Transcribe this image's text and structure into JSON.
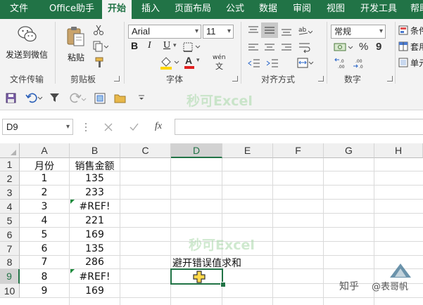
{
  "menu": {
    "tabs": [
      "文件",
      "Office助手",
      "开始",
      "插入",
      "页面布局",
      "公式",
      "数据",
      "审阅",
      "视图",
      "开发工具",
      "帮助"
    ],
    "active_tab": "开始"
  },
  "ribbon": {
    "wechat_label": "发送到微信",
    "file_transfer_label": "文件传输",
    "paste_label": "粘贴",
    "clipboard_label": "剪贴板",
    "font_name": "Arial",
    "font_size": "11",
    "bold": "B",
    "italic": "I",
    "underline": "U",
    "font_color_glyph": "A",
    "wen_glyph": "wén",
    "font_group_label": "字体",
    "alignment_group_label": "对齐方式",
    "number_format": "常规",
    "percent": "%",
    "comma": "9",
    "number_group_label": "数字",
    "cond_format_label": "条件",
    "table_format_label": "套用",
    "cell_style_label": "单元"
  },
  "watermark": "秒可Excel",
  "formula_bar": {
    "name_box": "D9",
    "fx": "fx",
    "formula": ""
  },
  "grid": {
    "columns": [
      "A",
      "B",
      "C",
      "D",
      "E",
      "F",
      "G",
      "H"
    ],
    "selected_column": "D",
    "rows": [
      "1",
      "2",
      "3",
      "4",
      "5",
      "6",
      "7",
      "8",
      "9",
      "10"
    ],
    "selected_row": "9",
    "cells": {
      "A1": "月份",
      "B1": "销售金额",
      "A2": "1",
      "B2": "135",
      "A3": "2",
      "B3": "233",
      "A4": "3",
      "B4": "#REF!",
      "A5": "4",
      "B5": "221",
      "A6": "5",
      "B6": "169",
      "A7": "6",
      "B7": "135",
      "A8": "7",
      "B8": "286",
      "A9": "8",
      "B9": "#REF!",
      "A10": "9",
      "B10": "169",
      "D8": "避开错误值求和",
      "D9": ""
    }
  },
  "branding": {
    "zhihu": "知乎",
    "at_name": "@表哥帆",
    "accent": "#217346"
  }
}
